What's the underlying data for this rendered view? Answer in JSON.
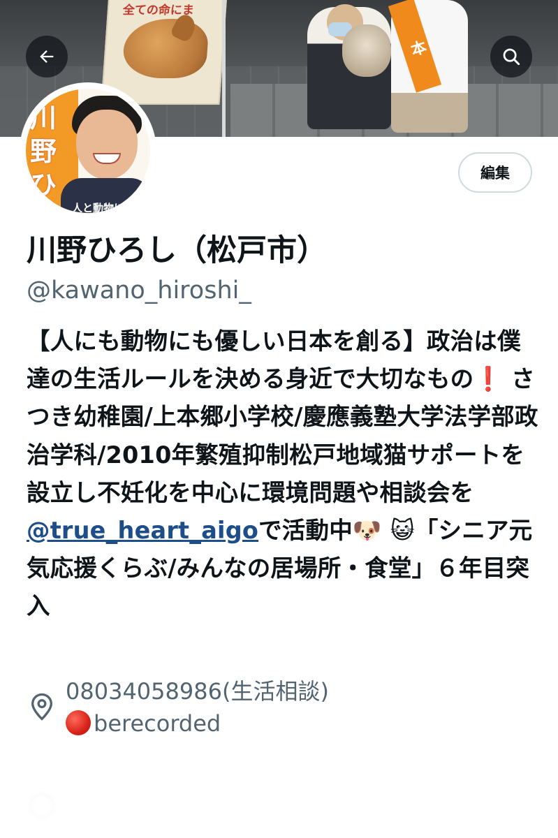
{
  "banner": {
    "poster_text": "全ての命にま",
    "sash_char": "本"
  },
  "nav": {
    "back_icon": "arrow-left-icon",
    "search_icon": "search-icon"
  },
  "avatar": {
    "kanji": "川野ひ",
    "caption": "人と動物に"
  },
  "actions": {
    "edit_label": "編集"
  },
  "profile": {
    "name": "川野ひろし（松戸市）",
    "handle": "@kawano_hiroshi_",
    "bio": {
      "part1": "【人にも動物にも優しい日本を創る】政治は僕達の生活ルールを決める身近で大切なもの",
      "emoji_exclaim": "❗",
      "part2": "さつき幼稚園/上本郷小学校/慶應義塾大学法学部政治学科/2010年繁殖抑制松戸地域猫サポートを設立し不妊化を中心に環境問題や相談会を",
      "mention": "@true_heart_aigo",
      "part3": "で活動中",
      "emoji_dog": "🐶",
      "emoji_cat": "😺",
      "part4": "「シニア元気応援くらぶ/みんなの居場所・食堂」６年目突入"
    },
    "location": {
      "icon": "location-pin-icon",
      "line1": "08034058986(生活相談)",
      "line2": "berecorded",
      "status_dot_color": "#d8231a"
    }
  },
  "colors": {
    "text_primary": "#0f1419",
    "text_secondary": "#536471",
    "link": "#1d4e89",
    "button_border": "#cfd9de"
  }
}
